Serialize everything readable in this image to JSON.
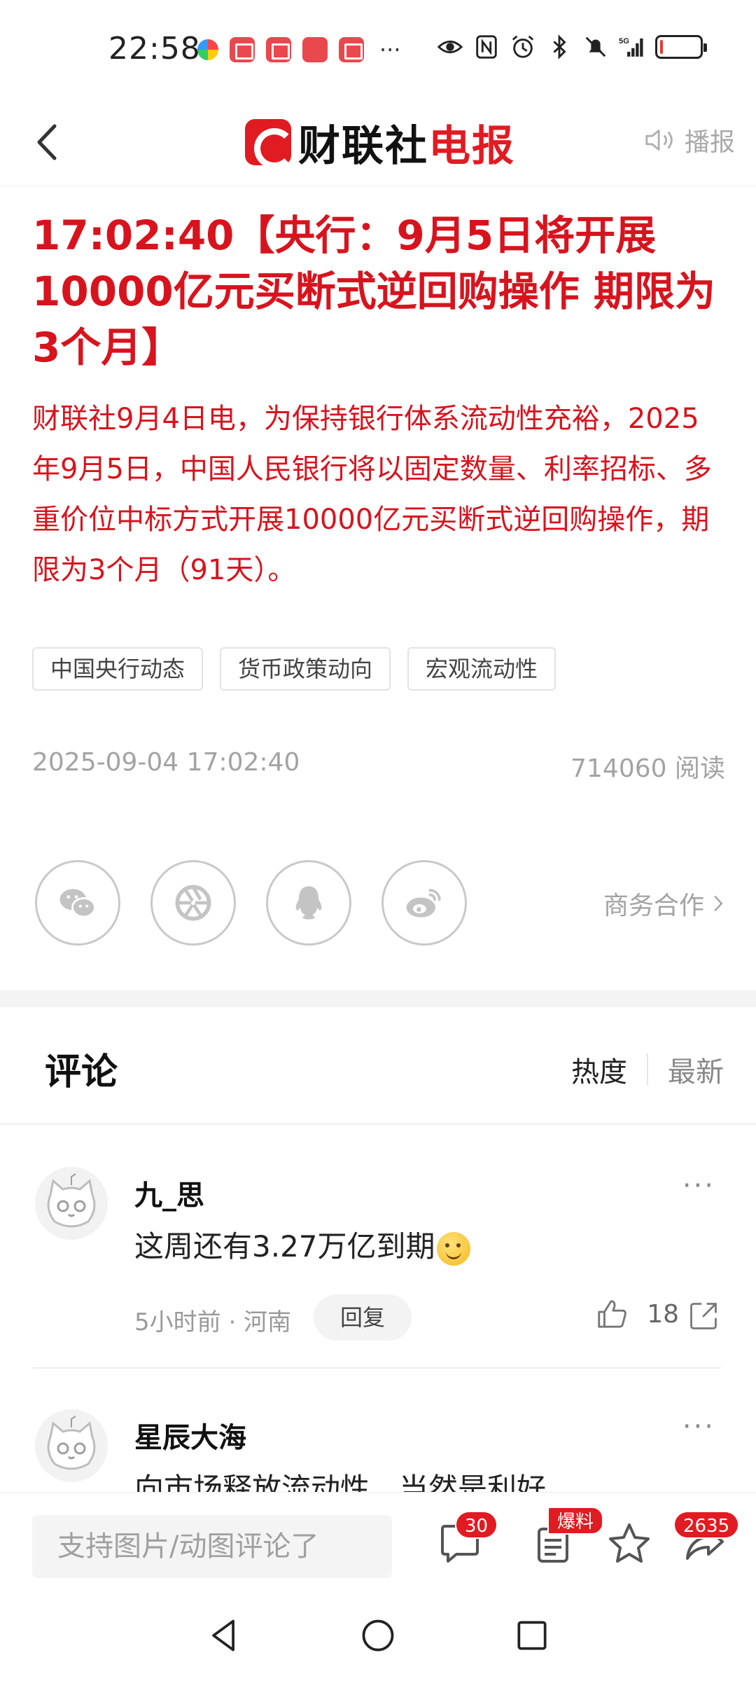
{
  "status_bar": {
    "time": "22:58",
    "more": "···",
    "network": "5G",
    "battery_level": 0.08,
    "battery_color": "#e53935"
  },
  "header": {
    "logo_black": "财联社",
    "logo_red": "电报",
    "broadcast_label": "播报",
    "brand_color": "#e11b22"
  },
  "article": {
    "headline": "17:02:40【央行：9月5日将开展10000亿元买断式逆回购操作 期限为3个月】",
    "body": "财联社9月4日电，为保持银行体系流动性充裕，2025年9月5日，中国人民银行将以固定数量、利率招标、多重价位中标方式开展10000亿元买断式逆回购操作，期限为3个月（91天）。",
    "tags": [
      "中国央行动态",
      "货币政策动向",
      "宏观流动性"
    ],
    "datetime": "2025-09-04 17:02:40",
    "reads": "714060 阅读",
    "headline_color": "#d7141e"
  },
  "share": {
    "icons": [
      "wechat-icon",
      "moments-icon",
      "qq-icon",
      "weibo-icon"
    ],
    "business_label": "商务合作"
  },
  "comments": {
    "title": "评论",
    "sort_hot": "热度",
    "sort_new": "最新",
    "items": [
      {
        "name": "九_思",
        "text": "这周还有3.27万亿到期",
        "meta": "5小时前 · 河南",
        "reply": "回复",
        "likes": "18",
        "more": "···"
      },
      {
        "name": "星辰大海",
        "text": "向市场释放流动性，当然是利好。",
        "more": "···"
      }
    ]
  },
  "bottom_bar": {
    "input_placeholder": "支持图片/动图评论了",
    "comment_count": "30",
    "tip_badge": "爆料",
    "share_count": "2635"
  }
}
